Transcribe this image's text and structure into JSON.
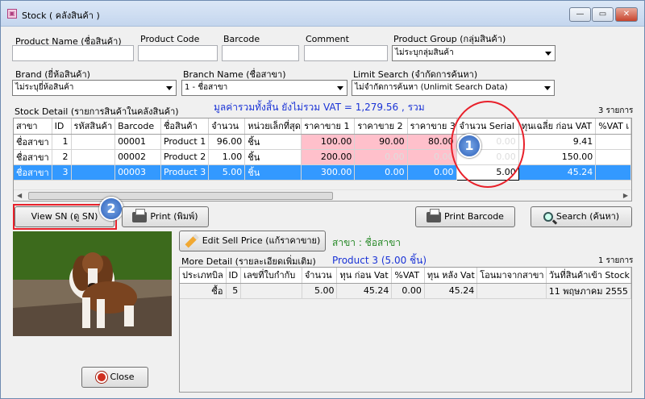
{
  "window": {
    "title": "Stock ( คลังสินค้า )",
    "icon": "app-icon"
  },
  "filters": {
    "product_name_label": "Product Name (ชื่อสินค้า)",
    "product_code_label": "Product Code",
    "barcode_label": "Barcode",
    "comment_label": "Comment",
    "product_group_label": "Product Group (กลุ่มสินค้า)",
    "product_group_value": "ไม่ระบุกลุ่มสินค้า",
    "brand_label": "Brand (ยี่ห้อสินค้า)",
    "brand_value": "ไม่ระบุยี่ห้อสินค้า",
    "branch_label": "Branch Name (ชื่อสาขา)",
    "branch_value": "1 - ชื่อสาขา",
    "limit_label": "Limit Search (จำกัดการค้นหา)",
    "limit_value": "ไม่จำกัดการค้นหา (Unlimit Search Data)"
  },
  "stock": {
    "title": "Stock Detail (รายการสินค้าในคลังสินค้า)",
    "vat_summary": "มูลค่ารวมทั้งสิ้น ยังไม่รวม VAT = 1,279.56 , รวม",
    "count": "3 รายการ",
    "columns": [
      "สาขา",
      "ID",
      "รหัสสินค้า",
      "Barcode",
      "ชื่อสินค้า",
      "จำนวน",
      "หน่วยเล็กที่สุด",
      "ราคาขาย 1",
      "ราคาขาย 2",
      "ราคาขาย 3",
      "จำนวน  Serial",
      "ทุนเฉลี่ย ก่อน VAT",
      "%VAT เ"
    ],
    "rows": [
      [
        "ชื่อสาขา",
        "1",
        "",
        "00001",
        "Product 1",
        "96.00",
        "ชิ้น",
        "100.00",
        "90.00",
        "80.00",
        "0.00",
        "9.41",
        ""
      ],
      [
        "ชื่อสาขา",
        "2",
        "",
        "00002",
        "Product 2",
        "1.00",
        "ชิ้น",
        "200.00",
        "0.00",
        "0.00",
        "0.00",
        "150.00",
        ""
      ],
      [
        "ชื่อสาขา",
        "3",
        "",
        "00003",
        "Product 3",
        "5.00",
        "ชิ้น",
        "300.00",
        "0.00",
        "0.00",
        "5.00",
        "45.24",
        ""
      ]
    ]
  },
  "buttons": {
    "view_sn": "View SN (ดู SN)",
    "print": "Print (พิมพ์)",
    "print_barcode": "Print Barcode",
    "search": "Search (ค้นหา)",
    "edit_sell_price": "Edit Sell Price (แก้ราคาขาย)",
    "close": "Close"
  },
  "badges": {
    "one": "1",
    "two": "2"
  },
  "more": {
    "branch": "สาขา : ชื่อสาขา",
    "title": "More Detail (รายละเอียดเพิ่มเติม)",
    "product": "Product 3 (5.00 ชิ้น)",
    "count": "1 รายการ",
    "columns": [
      "ประเภทบิล",
      "ID",
      "เลขที่ใบกำกับ",
      "จำนวน",
      "ทุน ก่อน Vat",
      "%VAT",
      "ทุน หลัง Vat",
      "โอนมาจากสาขา",
      "วันที่สินค้าเข้า Stock"
    ],
    "rows": [
      [
        "ซื้อ",
        "5",
        "",
        "5.00",
        "45.24",
        "0.00",
        "45.24",
        "",
        "11 พฤษภาคม 2555"
      ]
    ]
  },
  "colors": {
    "accent": "#3399ff",
    "highlight": "#ffc0cb",
    "annotation": "#e8202a",
    "info": "#1a33d6",
    "branch": "#2a8a2a"
  }
}
